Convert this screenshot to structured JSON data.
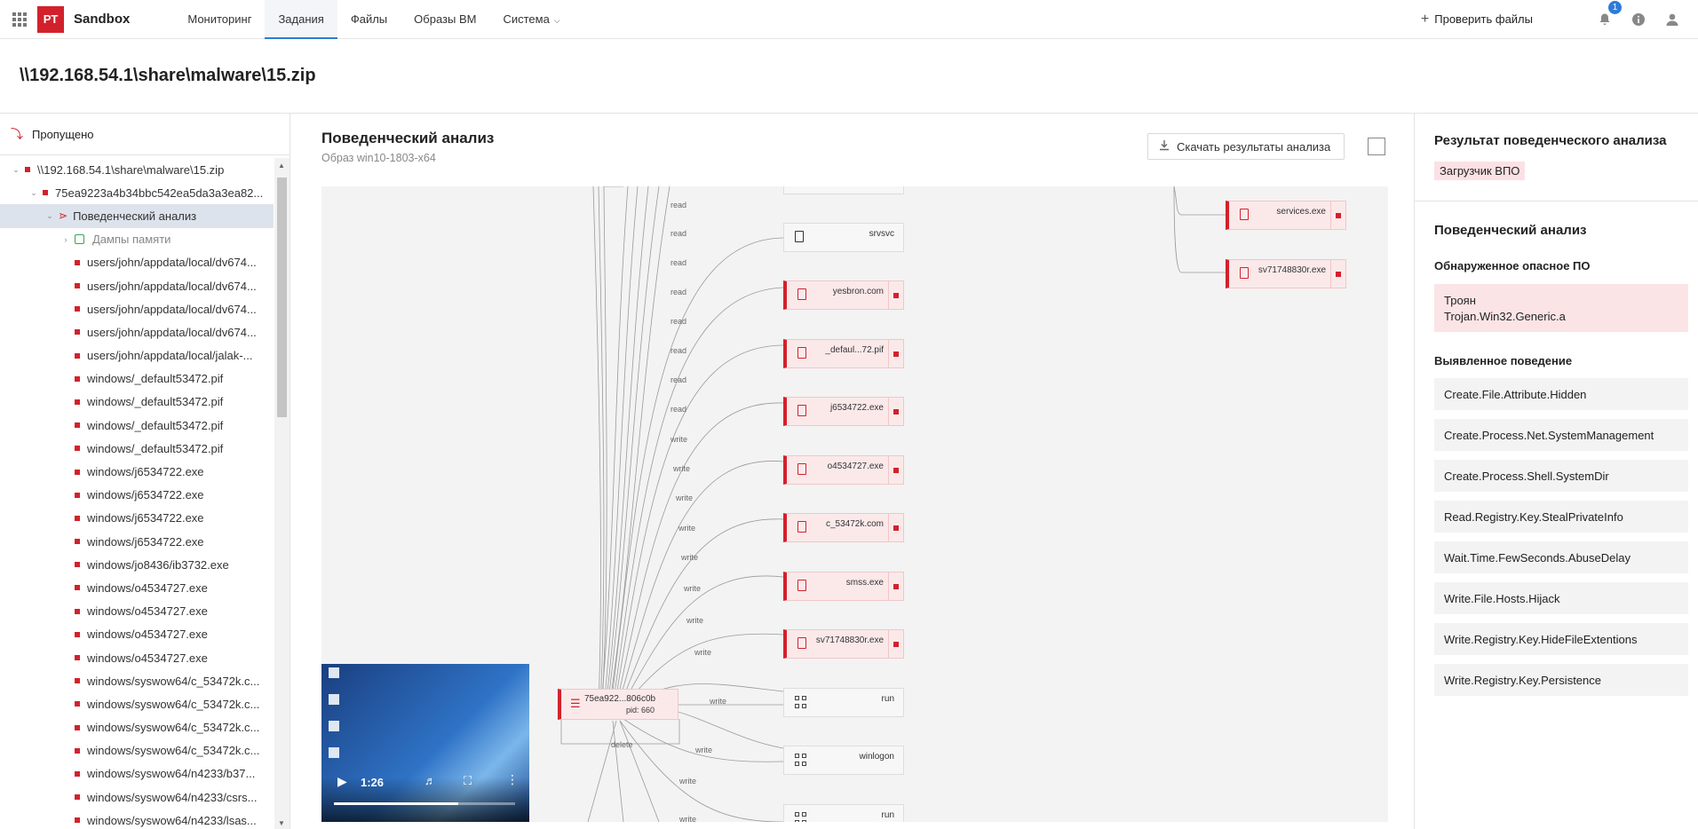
{
  "app": {
    "logo": "PT",
    "brand": "Sandbox"
  },
  "nav": {
    "tabs": [
      {
        "label": "Мониторинг"
      },
      {
        "label": "Задания"
      },
      {
        "label": "Файлы"
      },
      {
        "label": "Образы ВМ"
      },
      {
        "label": "Система"
      }
    ],
    "active_tab": "Задания",
    "check_files": "Проверить файлы",
    "notifications_count": "1"
  },
  "header": {
    "title": "\\\\192.168.54.1\\share\\malware\\15.zip"
  },
  "left": {
    "skipped": "Пропущено",
    "tree": [
      "\\\\192.168.54.1\\share\\malware\\15.zip",
      "75ea9223a4b34bbc542ea5da3a3ea82...",
      "Поведенческий анализ",
      "Дампы памяти",
      "users/john/appdata/local/dv674...",
      "users/john/appdata/local/dv674...",
      "users/john/appdata/local/dv674...",
      "users/john/appdata/local/dv674...",
      "users/john/appdata/local/jalak-...",
      "windows/_default53472.pif",
      "windows/_default53472.pif",
      "windows/_default53472.pif",
      "windows/_default53472.pif",
      "windows/j6534722.exe",
      "windows/j6534722.exe",
      "windows/j6534722.exe",
      "windows/j6534722.exe",
      "windows/jo8436/ib3732.exe",
      "windows/o4534727.exe",
      "windows/o4534727.exe",
      "windows/o4534727.exe",
      "windows/o4534727.exe",
      "windows/syswow64/c_53472k.c...",
      "windows/syswow64/c_53472k.c...",
      "windows/syswow64/c_53472k.c...",
      "windows/syswow64/c_53472k.c...",
      "windows/syswow64/n4233/b37...",
      "windows/syswow64/n4233/csrs...",
      "windows/syswow64/n4233/lsas..."
    ]
  },
  "center": {
    "title": "Поведенческий анализ",
    "subtitle": "Образ win10-1803-x64",
    "download": "Скачать результаты анализа",
    "graph": {
      "process_name": "75ea922...806c0b",
      "process_pid": "pid: 660",
      "nodes": [
        {
          "label": "srvsvc",
          "type": "plain"
        },
        {
          "label": "yesbron.com",
          "type": "red"
        },
        {
          "label": "_defaul...72.pif",
          "type": "red"
        },
        {
          "label": "j6534722.exe",
          "type": "red"
        },
        {
          "label": "o4534727.exe",
          "type": "red"
        },
        {
          "label": "c_53472k.com",
          "type": "red"
        },
        {
          "label": "smss.exe",
          "type": "red"
        },
        {
          "label": "sv71748830r.exe",
          "type": "red"
        },
        {
          "label": "run",
          "type": "reg"
        },
        {
          "label": "winlogon",
          "type": "reg"
        },
        {
          "label": "run",
          "type": "reg"
        },
        {
          "label": "services.exe",
          "type": "red"
        },
        {
          "label": "sv71748830r.exe",
          "type": "red"
        }
      ],
      "edge_labels": [
        "read",
        "read",
        "read",
        "read",
        "read",
        "read",
        "read",
        "read",
        "write",
        "write",
        "write",
        "write",
        "write",
        "write",
        "write",
        "write",
        "write",
        "write",
        "write",
        "delete",
        "write"
      ],
      "video_time": "1:26"
    }
  },
  "right": {
    "result_title": "Результат поведенческого анализа",
    "result_tag": "Загрузчик ВПО",
    "behavior_title": "Поведенческий анализ",
    "detected_label": "Обнаруженное опасное ПО",
    "threat_type": "Троян",
    "threat_name": "Trojan.Win32.Generic.a",
    "behavior_label": "Выявленное поведение",
    "behaviors": [
      "Create.File.Attribute.Hidden",
      "Create.Process.Net.SystemManagement",
      "Create.Process.Shell.SystemDir",
      "Read.Registry.Key.StealPrivateInfo",
      "Wait.Time.FewSeconds.AbuseDelay",
      "Write.File.Hosts.Hijack",
      "Write.Registry.Key.HideFileExtentions",
      "Write.Registry.Key.Persistence"
    ]
  }
}
